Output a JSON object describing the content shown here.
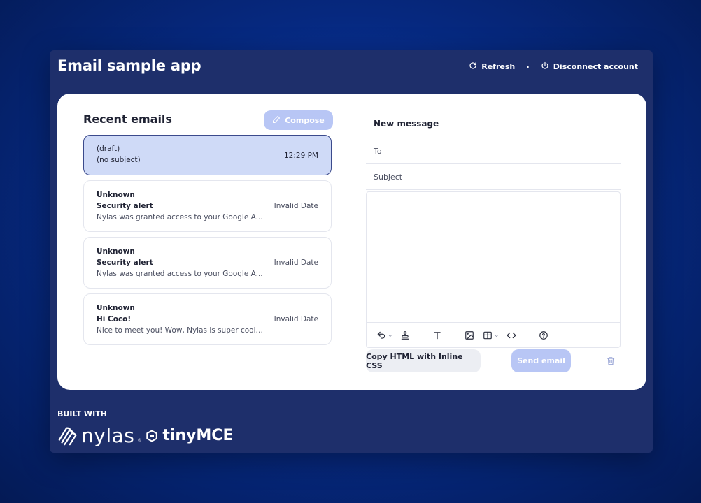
{
  "app": {
    "title": "Email sample app"
  },
  "header": {
    "refresh_label": "Refresh",
    "separator": "·",
    "disconnect_label": "Disconnect account"
  },
  "inbox": {
    "title": "Recent emails",
    "compose_label": "Compose",
    "emails": [
      {
        "from": "(draft)",
        "subject": "(no subject)",
        "snippet": "",
        "date": "12:29 PM",
        "selected": true
      },
      {
        "from": "Unknown",
        "subject": "Security alert",
        "snippet": "Nylas was granted access to your Google A...",
        "date": "Invalid Date",
        "selected": false
      },
      {
        "from": "Unknown",
        "subject": "Security alert",
        "snippet": "Nylas was granted access to your Google A...",
        "date": "Invalid Date",
        "selected": false
      },
      {
        "from": "Unknown",
        "subject": "Hi Coco!",
        "snippet": "Nice to meet you! Wow, Nylas is super cool! ...",
        "date": "Invalid Date",
        "selected": false
      }
    ]
  },
  "composer": {
    "title": "New message",
    "to_placeholder": "To",
    "subject_placeholder": "Subject",
    "body_value": "",
    "copy_label": "Copy HTML with Inline CSS",
    "send_label": "Send email"
  },
  "footer": {
    "built_with": "BUILT WITH",
    "brand1": "nylas",
    "brand1_tm": "®",
    "brand2": "tinyMCE"
  },
  "colors": {
    "background": "#06287e",
    "app_bg": "#1e2f6b",
    "accent_light": "#b8c6f5",
    "selected_bg": "#cfdaf7"
  },
  "icons": [
    "refresh-icon",
    "power-icon",
    "pencil-icon",
    "undo-icon",
    "stamp-icon",
    "text-icon",
    "image-icon",
    "table-icon",
    "code-icon",
    "help-icon",
    "trash-icon",
    "nylas-logo-icon",
    "tinymce-logo-icon"
  ]
}
